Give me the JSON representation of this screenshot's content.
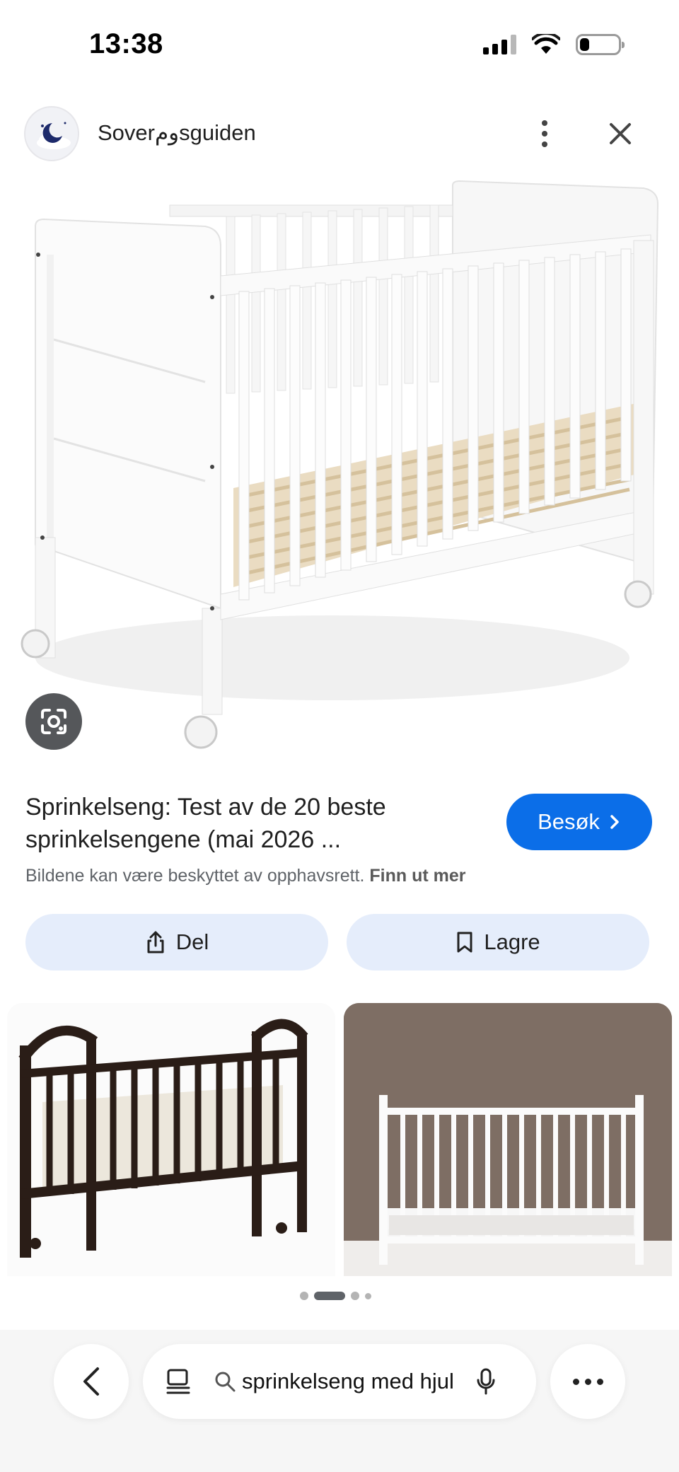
{
  "status_bar": {
    "time": "13:38",
    "icons": [
      "cellular-signal-icon",
      "wifi-icon",
      "battery-icon"
    ],
    "battery_level": 0.25
  },
  "source": {
    "name": "Soverومsguiden",
    "logo_icon": "moon-cloud-logo",
    "menu_icon": "kebab-menu-icon",
    "close_icon": "close-icon"
  },
  "image": {
    "subject_icon": "white-crib-with-wheels-image",
    "lens_icon": "google-lens-icon"
  },
  "result": {
    "title": "Sprinkelseng: Test av de 20 beste sprinkelsengene (mai 2026 ...",
    "visit_label": "Besøk",
    "copyright_text": "Bildene kan være beskyttet av opphavsrett.",
    "learn_more": "Finn ut mer"
  },
  "actions": {
    "share_label": "Del",
    "save_label": "Lagre"
  },
  "related": [
    "dark-wood-crib-image",
    "white-crib-image"
  ],
  "pager": {
    "active_index": 1,
    "count": 4
  },
  "bottom_bar": {
    "query": "sprinkelseng med hjul",
    "icons": [
      "back-chevron-icon",
      "tabs-icon",
      "search-icon",
      "microphone-icon",
      "more-icon"
    ]
  },
  "colors": {
    "accent": "#0b6ee8",
    "pill_bg": "#e5edfb"
  }
}
